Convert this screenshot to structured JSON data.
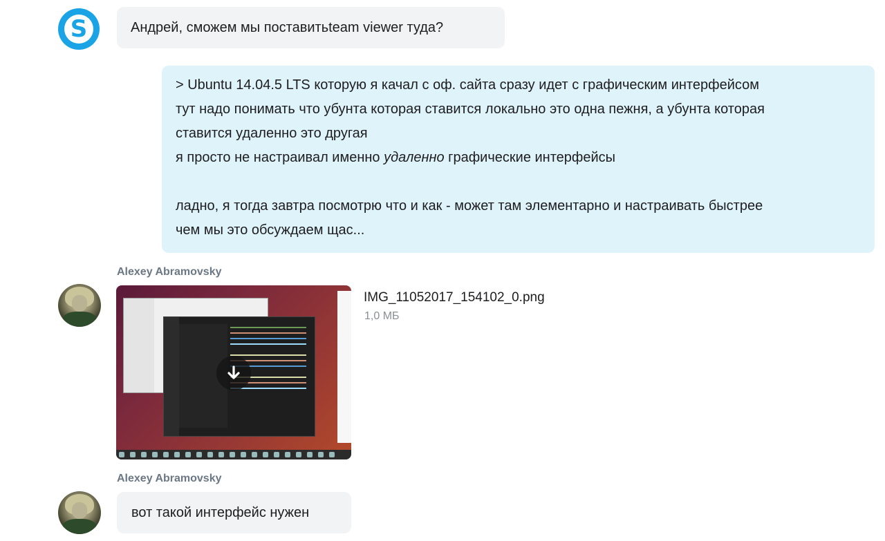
{
  "messages": {
    "m1": {
      "text": "Андрей, сможем мы поставитьteam viewer туда?"
    },
    "m2": {
      "lines": [
        "> Ubuntu 14.04.5 LTS которую я качал с оф. сайта сразу идет с графическим интерфейсом",
        "тут надо понимать что убунта которая ставится локально это одна пежня, а убунта которая",
        "ставится удаленно это другая"
      ],
      "line4_before": "я просто не настраивал именно ",
      "line4_em": "удаленно",
      "line4_after": " графические интерфейсы",
      "line5": "ладно, я тогда завтра посмотрю что и как - может там элементарно и настраивать быстрее",
      "line6": "чем мы это обсуждаем щас..."
    },
    "m3": {
      "sender": "Alexey Abramovsky",
      "file_name": "IMG_11052017_154102_0.png",
      "file_size": "1,0 МБ"
    },
    "m4": {
      "sender": "Alexey Abramovsky",
      "text": "вот такой интерфейс нужен"
    }
  },
  "icons": {
    "skype_avatar": "skype-logo-icon",
    "download": "download-arrow-icon"
  },
  "colors": {
    "skype_blue": "#1aa3e5",
    "outgoing_bubble": "#dff3fb",
    "incoming_bubble": "#f2f3f5",
    "sender_name": "#6b7785"
  }
}
